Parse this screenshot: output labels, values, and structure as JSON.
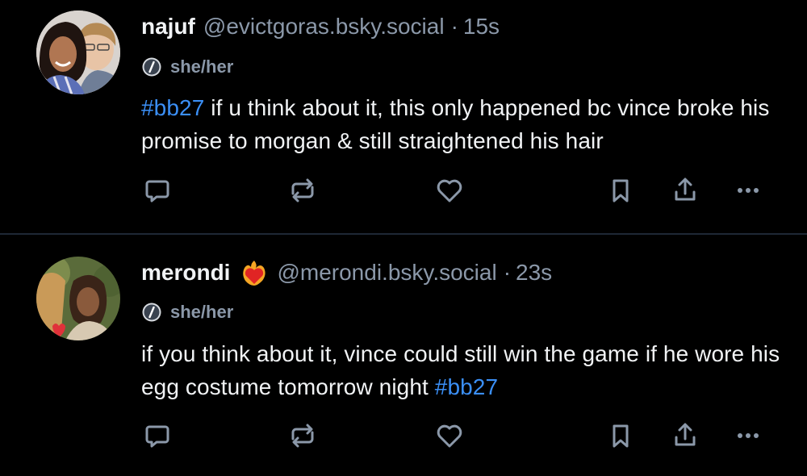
{
  "posts": [
    {
      "display_name": "najuf",
      "handle": "@evictgoras.bsky.social",
      "separator": "·",
      "time": "15s",
      "pronouns": "she/her",
      "text_parts": [
        "#bb27",
        " if u think about it, this only happened bc vince broke his promise to morgan & still straightened his hair",
        ""
      ],
      "avatar_icon": "avatar-photo-two-people",
      "badge_icon": "slash-badge-icon"
    },
    {
      "display_name": "merondi",
      "handle": "@merondi.bsky.social",
      "separator": "·",
      "time": "23s",
      "pronouns": "she/her",
      "text_parts": [
        "",
        "if you think about it, vince could still win the game if he wore his egg costume tomorrow night ",
        "#bb27"
      ],
      "name_emoji": "heart-on-fire-emoji",
      "avatar_icon": "avatar-photo-woman",
      "badge_icon": "slash-badge-icon"
    }
  ],
  "actions": [
    "reply-icon",
    "repost-icon",
    "like-icon",
    "bookmark-icon",
    "share-icon",
    "more-icon"
  ],
  "colors": {
    "background": "#000000",
    "text": "#f1f3f5",
    "muted": "#8b98a9",
    "hashtag": "#3b8ff6",
    "divider": "#1e2835"
  }
}
